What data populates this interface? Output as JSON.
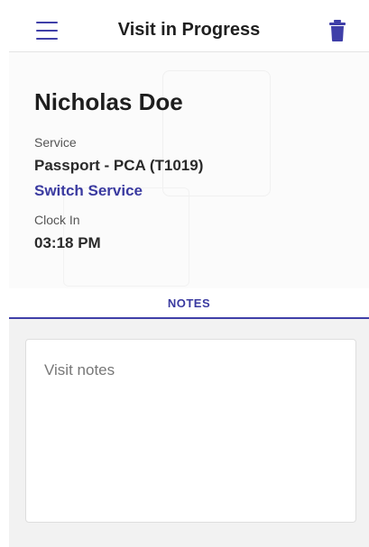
{
  "header": {
    "title": "Visit in Progress",
    "menu_icon": "hamburger-menu-icon",
    "delete_icon": "trash-icon"
  },
  "visit": {
    "client_name": "Nicholas Doe",
    "service_label": "Service",
    "service_value": "Passport - PCA (T1019)",
    "switch_service": "Switch Service",
    "clock_in_label": "Clock In",
    "clock_in_value": "03:18 PM"
  },
  "tabs": [
    {
      "label": "NOTES",
      "active": true
    }
  ],
  "notes": {
    "placeholder": "Visit notes",
    "value": ""
  },
  "colors": {
    "accent": "#3f3fa8",
    "link": "#3a3aa0",
    "notes_background": "#f2f2f2"
  }
}
